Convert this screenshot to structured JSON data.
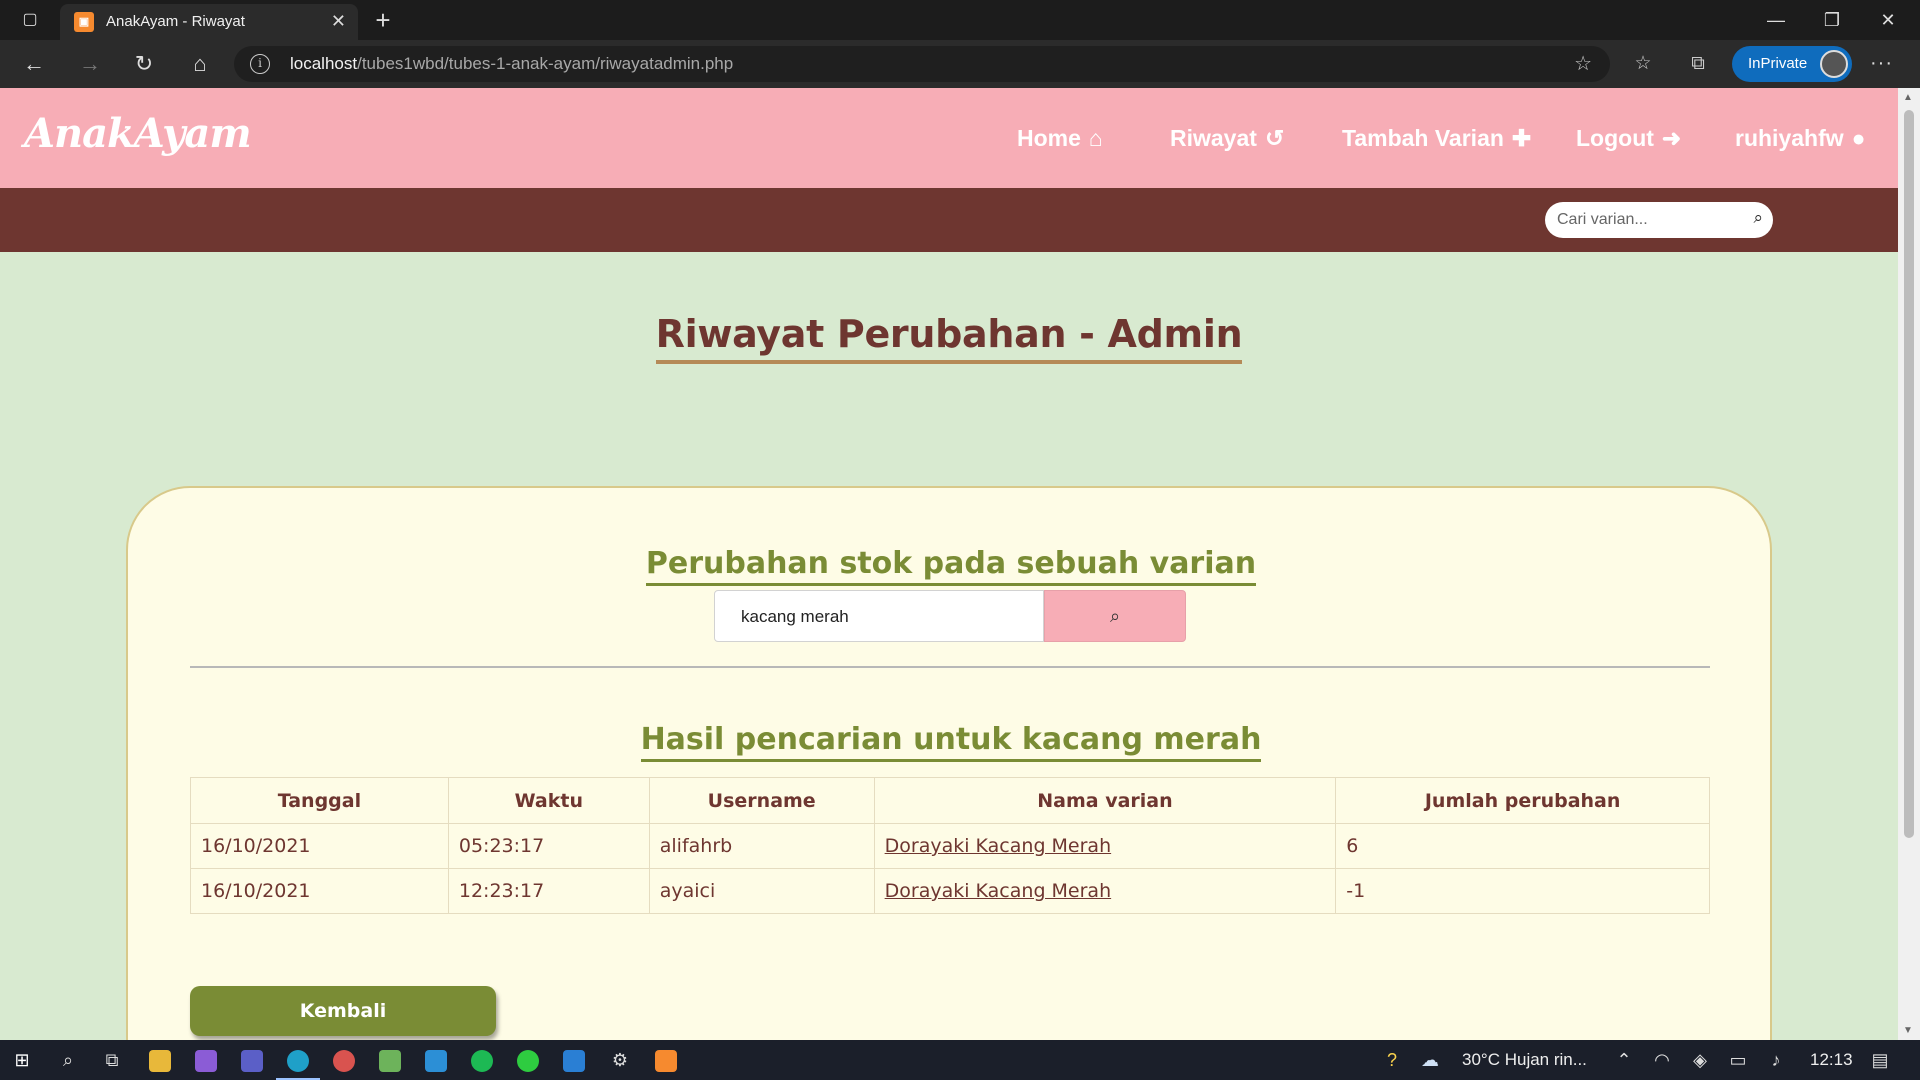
{
  "browser": {
    "tab_title": "AnakAyam - Riwayat",
    "tab_close": "✕",
    "new_tab": "+",
    "url_host": "localhost",
    "url_path": "/tubes1wbd/tubes-1-anak-ayam/riwayatadmin.php",
    "inprivate_label": "InPrivate",
    "more": "···"
  },
  "site": {
    "brand": "AnakAyam",
    "nav": [
      {
        "label": "Home",
        "icon": "home-icon"
      },
      {
        "label": "Riwayat",
        "icon": "history-icon"
      },
      {
        "label": "Tambah Varian",
        "icon": "plus-icon"
      },
      {
        "label": "Logout",
        "icon": "logout-icon"
      },
      {
        "label": "ruhiyahfw",
        "icon": "user-icon"
      }
    ],
    "search_placeholder": "Cari varian..."
  },
  "main": {
    "page_title": "Riwayat Perubahan - Admin",
    "section_title": "Perubahan stok pada sebuah varian",
    "search_value": "kacang merah",
    "results_title": "Hasil pencarian untuk kacang merah",
    "table": {
      "headers": [
        "Tanggal",
        "Waktu",
        "Username",
        "Nama varian",
        "Jumlah perubahan"
      ],
      "rows": [
        [
          "16/10/2021",
          "05:23:17",
          "alifahrb",
          "Dorayaki Kacang Merah",
          "6"
        ],
        [
          "16/10/2021",
          "12:23:17",
          "ayaici",
          "Dorayaki Kacang Merah",
          "-1"
        ]
      ]
    },
    "back_button": "Kembali"
  },
  "taskbar": {
    "weather": "30°C  Hujan rin...",
    "clock": "12:13"
  },
  "colors": {
    "nav_pink": "#f7adb6",
    "brown": "#6e3630",
    "olive": "#7a8c35",
    "page_bg": "#d8ead0",
    "card_bg": "#fefce6"
  }
}
